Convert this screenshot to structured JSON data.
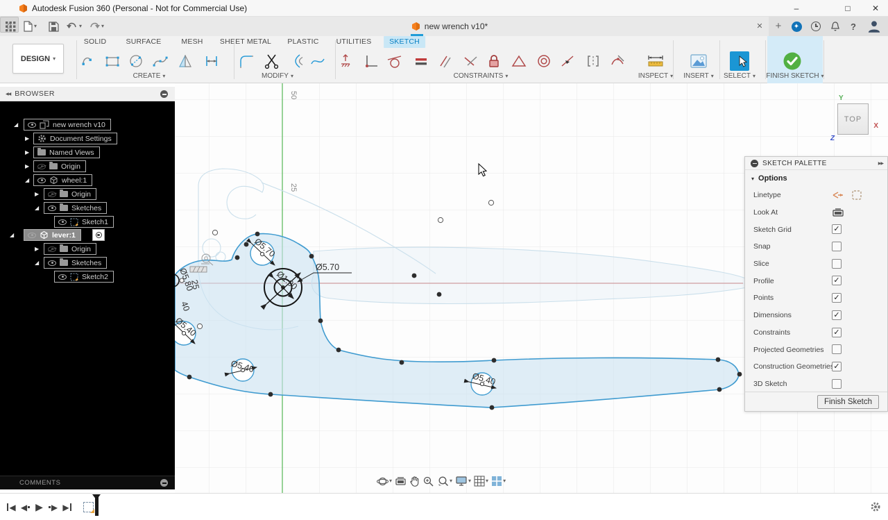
{
  "window": {
    "title": "Autodesk Fusion 360 (Personal - Not for Commercial Use)",
    "controls": {
      "minimize": "–",
      "maximize": "□",
      "close": "✕"
    }
  },
  "glyphs": {
    "caret_down": "▾",
    "tree_expanded": "◢",
    "tree_collapsed": "▶",
    "collapse_left": "◀◀",
    "panel_forward": "▶▶",
    "close": "✕",
    "plus": "+",
    "home": "⌂",
    "help": "?",
    "play": "▶",
    "back": "◀"
  },
  "doc_tab": {
    "label": "new wrench v10*"
  },
  "ribbon": {
    "workspace": "DESIGN",
    "tabs": [
      {
        "label": "SOLID"
      },
      {
        "label": "SURFACE"
      },
      {
        "label": "MESH"
      },
      {
        "label": "SHEET METAL"
      },
      {
        "label": "PLASTIC"
      },
      {
        "label": "UTILITIES"
      },
      {
        "label": "SKETCH"
      }
    ],
    "groups": [
      {
        "label": "CREATE"
      },
      {
        "label": "MODIFY"
      },
      {
        "label": "CONSTRAINTS"
      },
      {
        "label": "INSPECT"
      },
      {
        "label": "INSERT"
      },
      {
        "label": "SELECT"
      },
      {
        "label": "FINISH SKETCH"
      }
    ]
  },
  "browser": {
    "header": "BROWSER",
    "comments": "COMMENTS",
    "tree": [
      {
        "label": "new wrench v10"
      },
      {
        "label": "Document Settings"
      },
      {
        "label": "Named Views"
      },
      {
        "label": "Origin"
      },
      {
        "label": "wheel:1"
      },
      {
        "label": "Origin"
      },
      {
        "label": "Sketches"
      },
      {
        "label": "Sketch1"
      },
      {
        "label": "lever:1"
      },
      {
        "label": "Origin"
      },
      {
        "label": "Sketches"
      },
      {
        "label": "Sketch2"
      }
    ]
  },
  "palette": {
    "header": "SKETCH PALETTE",
    "section": "Options",
    "rows": [
      {
        "label": "Linetype",
        "check": ""
      },
      {
        "label": "Look At",
        "check": ""
      },
      {
        "label": "Sketch Grid",
        "check": "✓"
      },
      {
        "label": "Snap",
        "check": ""
      },
      {
        "label": "Slice",
        "check": ""
      },
      {
        "label": "Profile",
        "check": "✓"
      },
      {
        "label": "Points",
        "check": "✓"
      },
      {
        "label": "Dimensions",
        "check": "✓"
      },
      {
        "label": "Constraints",
        "check": "✓"
      },
      {
        "label": "Projected Geometries",
        "check": ""
      },
      {
        "label": "Construction Geometries",
        "check": "✓"
      },
      {
        "label": "3D Sketch",
        "check": ""
      }
    ],
    "finish_button": "Finish Sketch"
  },
  "viewcube": {
    "face": "TOP",
    "axis_x": "X",
    "axis_y": "Y",
    "axis_z": "Z"
  },
  "canvas": {
    "ruler": [
      "50",
      "25"
    ],
    "dims": {
      "top_circle": "Ø5.70",
      "center_leader": "Ø5.70",
      "center_rot": "Ø1.90",
      "left_circle": "Ø5.40",
      "mid_circle": "Ø5.40",
      "right_circle": "Ø5.40",
      "clipped": [
        "Ø5.80",
        "25",
        "40"
      ]
    }
  },
  "colors": {
    "accent_blue": "#1f9cd7",
    "sketch_stroke": "#3f9bd0",
    "sketch_fill": "#cbe3f2",
    "axis_red": "#cf8a8a",
    "axis_green": "#6cc06c",
    "constraint_red": "#b04a4a",
    "finish_green": "#52b043"
  }
}
